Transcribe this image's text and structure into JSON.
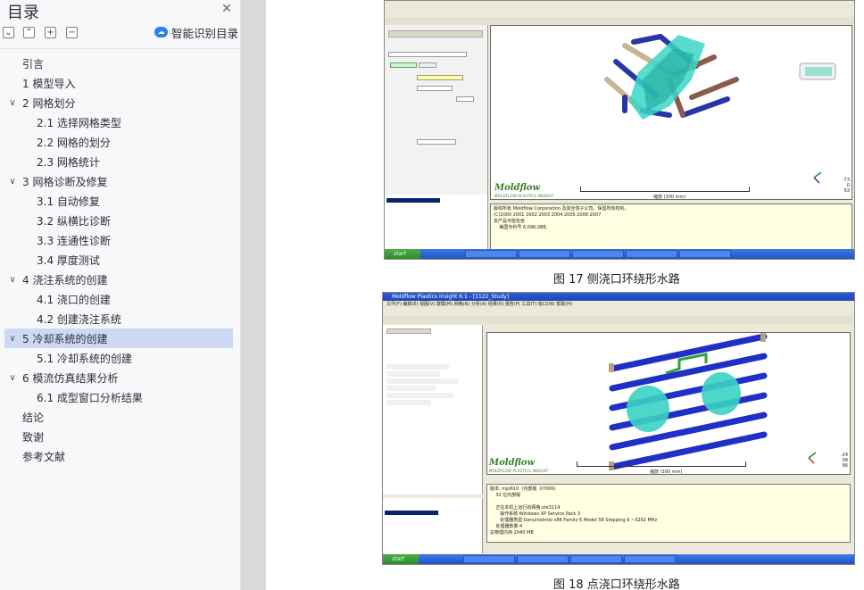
{
  "sidebar": {
    "title": "目录",
    "smart_toc_label": "智能识别目录",
    "tools": [
      "expand-all",
      "collapse-up",
      "add",
      "remove"
    ],
    "items": [
      {
        "label": "引言",
        "level": 0,
        "expandable": false
      },
      {
        "label": "1 模型导入",
        "level": 0,
        "expandable": false
      },
      {
        "label": "2 网格划分",
        "level": 0,
        "expandable": true
      },
      {
        "label": "2.1  选择网格类型",
        "level": 1,
        "expandable": false
      },
      {
        "label": "2.2 网格的划分",
        "level": 1,
        "expandable": false
      },
      {
        "label": "2.3 网格统计",
        "level": 1,
        "expandable": false
      },
      {
        "label": "3 网格诊断及修复",
        "level": 0,
        "expandable": true
      },
      {
        "label": "3.1 自动修复",
        "level": 1,
        "expandable": false
      },
      {
        "label": "3.2 纵横比诊断",
        "level": 1,
        "expandable": false
      },
      {
        "label": "3.3 连通性诊断",
        "level": 1,
        "expandable": false
      },
      {
        "label": "3.4 厚度测试",
        "level": 1,
        "expandable": false
      },
      {
        "label": "4 浇注系统的创建",
        "level": 0,
        "expandable": true
      },
      {
        "label": "4.1 浇口的创建",
        "level": 1,
        "expandable": false
      },
      {
        "label": "4.2 创建浇注系统",
        "level": 1,
        "expandable": false
      },
      {
        "label": "5 冷却系统的创建",
        "level": 0,
        "expandable": true,
        "active": true
      },
      {
        "label": "5.1 冷却系统的创建",
        "level": 1,
        "expandable": false
      },
      {
        "label": "6 模流仿真结果分析",
        "level": 0,
        "expandable": true
      },
      {
        "label": "6.1 成型窗口分析结果",
        "level": 1,
        "expandable": false
      },
      {
        "label": "结论",
        "level": 0,
        "expandable": false
      },
      {
        "label": "致谢",
        "level": 0,
        "expandable": false
      },
      {
        "label": "参考文献",
        "level": 0,
        "expandable": false
      }
    ]
  },
  "document": {
    "figure17": {
      "caption": "图 17  侧浇口环绕形水路",
      "logo": "Moldflow",
      "logo_sub": "MOLDFLOW PLASTICS INSIGHT",
      "scale_label": "缩放 (300 mm)",
      "axis_nums": "-73\n0\n63",
      "log_text": "版权所有 Moldflow Corporation 及其全球子公司。保留所有权利。\n(C)2000 2001 2002 2003 2004 2005 2006 2007\n本产品可能包含\n    美国专利号 6,096,088。"
    },
    "figure18": {
      "caption": "图 18  点浇口环绕形水路",
      "title_bar": "Moldflow Plastics Insight 6.1 - [1122_Study]",
      "logo": "Moldflow",
      "logo_sub": "MOLDFLOW PLASTICS INSIGHT",
      "scale_label": "缩放 (300 mm)",
      "axis_nums": "-24\n58\n86",
      "log_text": "版本: mpi610  (内部版  07006)\n    32 位内部版\n\n    正在本机上运行的网格:ste3114\n       操作系统:Windows XP Service Pack 3\n       处理器类型:GenuineIntel x86 Family 6 Model 58 Stepping 9 ~3292 MHz\n    处理器数量:4\n总物理内存:2040 MB"
    }
  }
}
